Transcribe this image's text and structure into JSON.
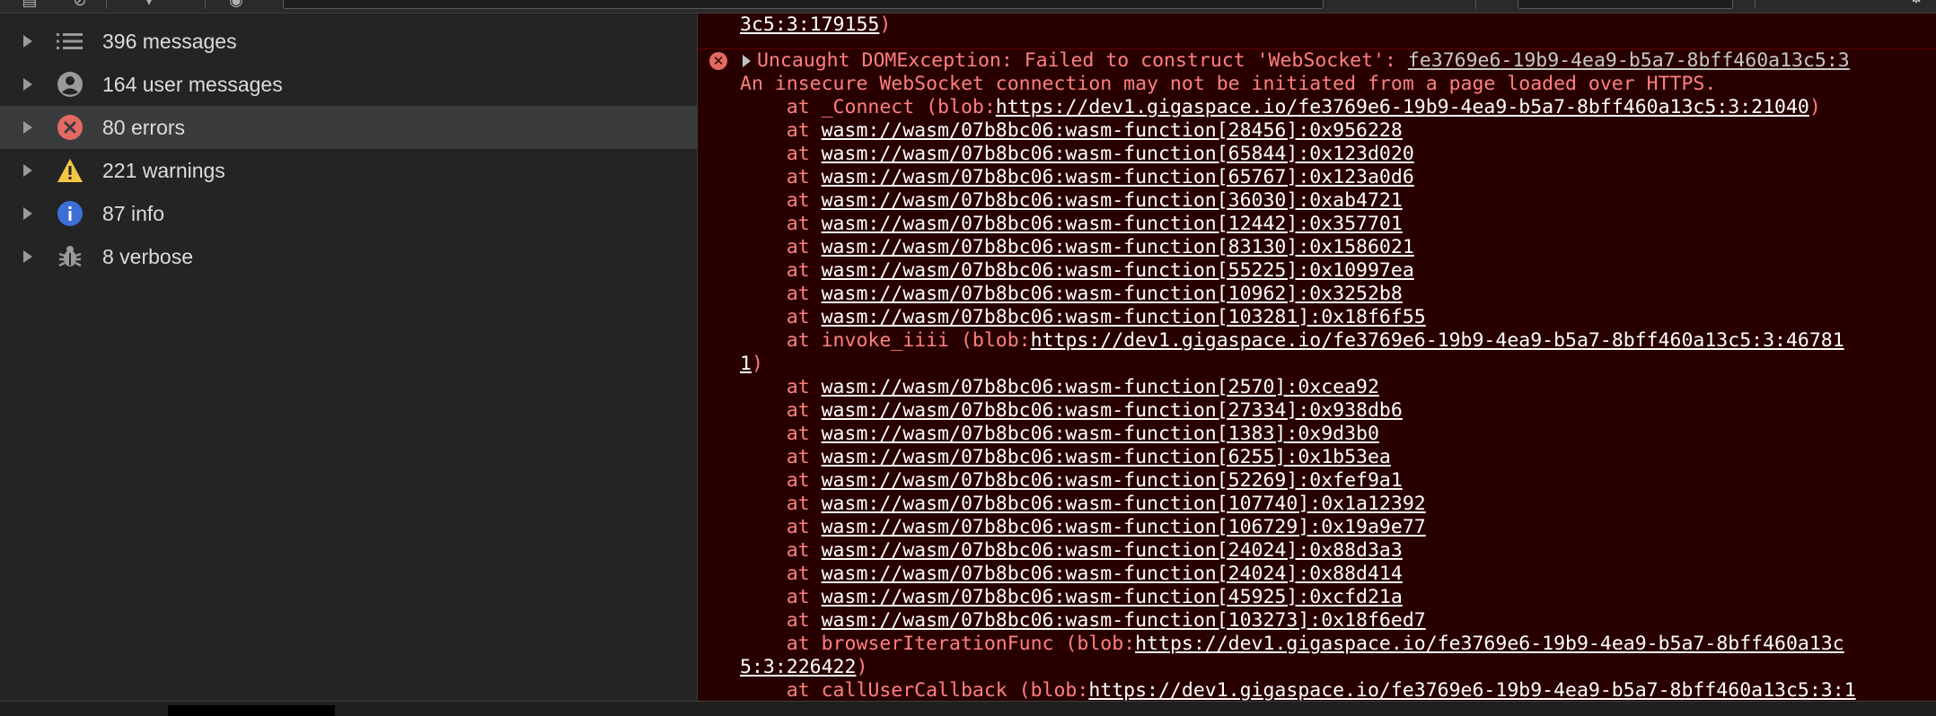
{
  "sidebar": {
    "items": [
      {
        "label": "396 messages",
        "icon": "list-icon"
      },
      {
        "label": "164 user messages",
        "icon": "user-circle-icon"
      },
      {
        "label": "80 errors",
        "icon": "error-icon",
        "selected": true
      },
      {
        "label": "221 warnings",
        "icon": "warning-icon"
      },
      {
        "label": "87 info",
        "icon": "info-icon"
      },
      {
        "label": "8 verbose",
        "icon": "bug-icon"
      }
    ]
  },
  "colors": {
    "console_bg": "#290000",
    "error_text": "#ff8080",
    "error_icon": "#e46962",
    "warning_icon": "#f2c744",
    "info_icon": "#3d6fd9",
    "sidebar_selected": "#393b3d"
  },
  "console": {
    "top_continuation": "3c5:3:179155",
    "top_continuation_suffix": ")",
    "error_header": {
      "text": "Uncaught DOMException: Failed to construct 'WebSocket': ",
      "source_link": "fe3769e6-19b9-4ea9-b5a7-8bff460a13c5:3"
    },
    "error_message": "An insecure WebSocket connection may not be initiated from a page loaded over HTTPS.",
    "connect_frame": {
      "prefix": "    at _Connect (blob:",
      "link": "https://dev1.gigaspace.io/fe3769e6-19b9-4ea9-b5a7-8bff460a13c5:3:21040",
      "suffix": ")"
    },
    "frames_a": [
      "wasm://wasm/07b8bc06:wasm-function[28456]:0x956228",
      "wasm://wasm/07b8bc06:wasm-function[65844]:0x123d020",
      "wasm://wasm/07b8bc06:wasm-function[65767]:0x123a0d6",
      "wasm://wasm/07b8bc06:wasm-function[36030]:0xab4721",
      "wasm://wasm/07b8bc06:wasm-function[12442]:0x357701",
      "wasm://wasm/07b8bc06:wasm-function[83130]:0x1586021",
      "wasm://wasm/07b8bc06:wasm-function[55225]:0x10997ea",
      "wasm://wasm/07b8bc06:wasm-function[10962]:0x3252b8",
      "wasm://wasm/07b8bc06:wasm-function[103281]:0x18f6f55"
    ],
    "invoke_frame": {
      "prefix": "    at invoke_iiii (blob:",
      "link": "https://dev1.gigaspace.io/fe3769e6-19b9-4ea9-b5a7-8bff460a13c5:3:46781",
      "wrap": "1",
      "suffix": ")"
    },
    "frames_b": [
      "wasm://wasm/07b8bc06:wasm-function[2570]:0xcea92",
      "wasm://wasm/07b8bc06:wasm-function[27334]:0x938db6",
      "wasm://wasm/07b8bc06:wasm-function[1383]:0x9d3b0",
      "wasm://wasm/07b8bc06:wasm-function[6255]:0x1b53ea",
      "wasm://wasm/07b8bc06:wasm-function[52269]:0xfef9a1",
      "wasm://wasm/07b8bc06:wasm-function[107740]:0x1a12392",
      "wasm://wasm/07b8bc06:wasm-function[106729]:0x19a9e77",
      "wasm://wasm/07b8bc06:wasm-function[24024]:0x88d3a3",
      "wasm://wasm/07b8bc06:wasm-function[24024]:0x88d414",
      "wasm://wasm/07b8bc06:wasm-function[45925]:0xcfd21a",
      "wasm://wasm/07b8bc06:wasm-function[103273]:0x18f6ed7"
    ],
    "browser_frame": {
      "prefix": "    at browserIterationFunc (blob:",
      "link": "https://dev1.gigaspace.io/fe3769e6-19b9-4ea9-b5a7-8bff460a13c",
      "wrap": "5:3:226422",
      "suffix": ")"
    },
    "callback_frame": {
      "prefix": "    at callUserCallback (blob:",
      "link": "https://dev1.gigaspace.io/fe3769e6-19b9-4ea9-b5a7-8bff460a13c5:3:1"
    },
    "at_prefix": "    at "
  }
}
